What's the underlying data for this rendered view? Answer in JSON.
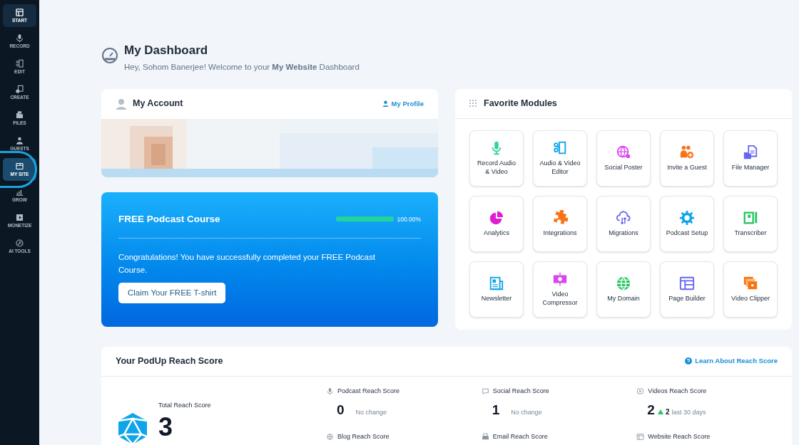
{
  "sidebar": {
    "items": [
      {
        "label": "START",
        "kind": "start",
        "selected": true,
        "highlighted": false
      },
      {
        "label": "RECORD",
        "kind": "record",
        "selected": false,
        "highlighted": false
      },
      {
        "label": "EDIT",
        "kind": "edit",
        "selected": false,
        "highlighted": false
      },
      {
        "label": "CREATE",
        "kind": "create",
        "selected": false,
        "highlighted": false
      },
      {
        "label": "FILES",
        "kind": "files",
        "selected": false,
        "highlighted": false
      },
      {
        "label": "GUESTS",
        "kind": "guests",
        "selected": false,
        "highlighted": false
      },
      {
        "label": "MY SITE",
        "kind": "site",
        "selected": false,
        "highlighted": true
      },
      {
        "label": "GROW",
        "kind": "grow",
        "selected": false,
        "highlighted": false
      },
      {
        "label": "MONETIZE",
        "kind": "monetize",
        "selected": false,
        "highlighted": false
      },
      {
        "label": "AI TOOLS",
        "kind": "ai",
        "selected": false,
        "highlighted": false
      }
    ]
  },
  "header": {
    "title": "My Dashboard",
    "subtitle": "Hey, Sohom Banerjee! Welcome to your **My Website** Dashboard"
  },
  "account": {
    "title": "My Account",
    "link": "My Profile"
  },
  "course": {
    "title": "FREE Podcast Course",
    "level": 1,
    "reading": "100.00%",
    "message": "Congratulations! You have successfully completed your FREE Podcast Course.",
    "button": "Claim Your FREE T-shirt"
  },
  "favorites": {
    "title": "Favorite Modules",
    "modules": [
      {
        "label": "Record Audio & Video",
        "kind": "mic",
        "color": "#34d399"
      },
      {
        "label": "Audio & Video Editor",
        "kind": "editor",
        "color": "#0ea5e9"
      },
      {
        "label": "Social Poster",
        "kind": "globe-share",
        "color": "#d946ef"
      },
      {
        "label": "Invite a Guest",
        "kind": "guest",
        "color": "#f97316"
      },
      {
        "label": "File Manager",
        "kind": "file",
        "color": "#6366f1"
      },
      {
        "label": "Analytics",
        "kind": "pie",
        "color": "#e11dd4"
      },
      {
        "label": "Integrations",
        "kind": "puzzle",
        "color": "#f97316"
      },
      {
        "label": "Migrations",
        "kind": "cloud",
        "color": "#6366f1"
      },
      {
        "label": "Podcast Setup",
        "kind": "gear",
        "color": "#0ea5e9"
      },
      {
        "label": "Transcriber",
        "kind": "notebook",
        "color": "#22c55e"
      },
      {
        "label": "Newsletter",
        "kind": "news",
        "color": "#0ea5e9"
      },
      {
        "label": "Video Compressor",
        "kind": "film",
        "color": "#d946ef"
      },
      {
        "label": "My Domain",
        "kind": "globe",
        "color": "#22c55e"
      },
      {
        "label": "Page Builder",
        "kind": "layout",
        "color": "#6366f1"
      },
      {
        "label": "Video Clipper",
        "kind": "clips",
        "color": "#f97316"
      }
    ]
  },
  "reach": {
    "title": "Your PodUp Reach Score",
    "link": "Learn About Reach Score",
    "total_label": "Total Reach Score",
    "total": "3",
    "scores": [
      {
        "label": "Podcast Reach Score",
        "kind": "mic",
        "value": "0",
        "change": "No change",
        "rising": false
      },
      {
        "label": "Social Reach Score",
        "kind": "chat",
        "value": "1",
        "change": "No change",
        "rising": false
      },
      {
        "label": "Videos Reach Score",
        "kind": "video",
        "value": "2",
        "delta": "2",
        "change": "last 30 days",
        "rising": true
      },
      {
        "label": "Blog Reach Score",
        "kind": "globe"
      },
      {
        "label": "Email Reach Score",
        "kind": "mail"
      },
      {
        "label": "Website Reach Score",
        "kind": "site"
      }
    ]
  }
}
